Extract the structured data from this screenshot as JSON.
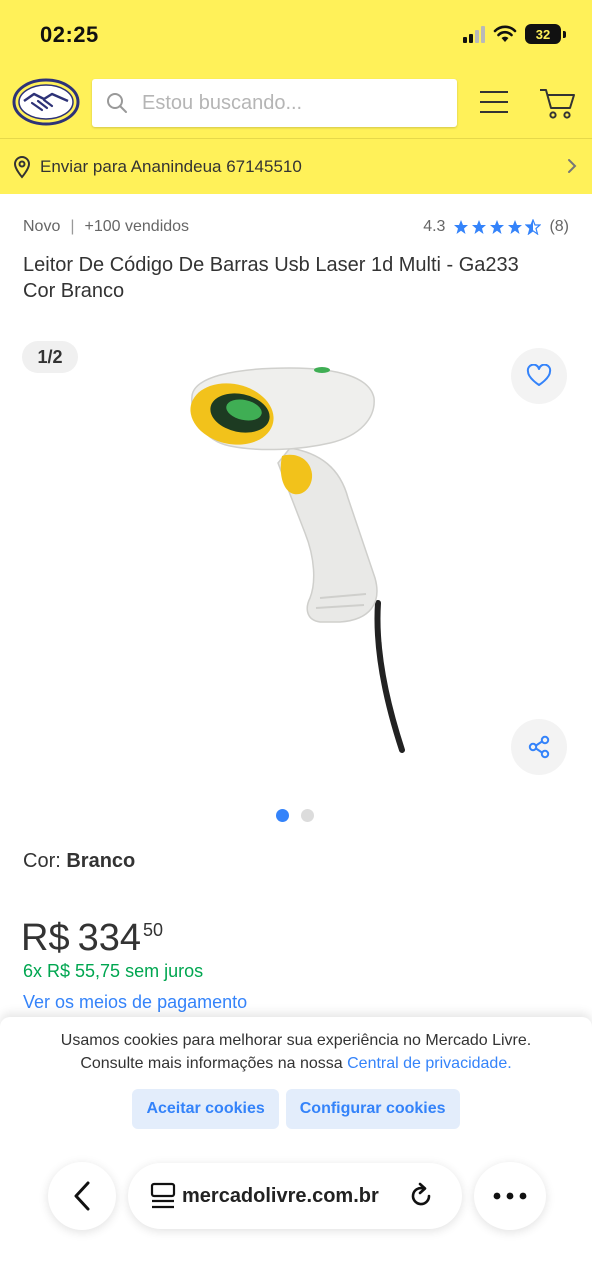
{
  "status_bar": {
    "time": "02:25",
    "battery": "32"
  },
  "header": {
    "logo": "mercado-livre-handshake-logo",
    "search_placeholder": "Estou buscando...",
    "icons": [
      "search-icon",
      "menu-icon",
      "cart-icon"
    ],
    "brand_color": "#fff159"
  },
  "delivery": {
    "text": "Enviar para Ananindeua 67145510"
  },
  "product": {
    "condition": "Novo",
    "separator": "|",
    "sold": "+100 vendidos",
    "rating": "4.3",
    "rating_stars": 4.3,
    "reviews": "(8)",
    "title": "Leitor De Código De Barras Usb Laser 1d Multi - Ga233 Cor Branco"
  },
  "gallery": {
    "page_indicator": "1/2",
    "total_images": 2,
    "current_image": 1
  },
  "variant": {
    "label": "Cor: ",
    "value": "Branco"
  },
  "price": {
    "currency": "R$",
    "integer": "334",
    "cents": "50",
    "installments": "6x R$ 55,75 sem juros",
    "payment_link": "Ver os meios de pagamento"
  },
  "cookies": {
    "text_line1": "Usamos cookies para melhorar sua experiência no Mercado Livre.",
    "text_line2_prefix": "Consulte mais informações na nossa ",
    "privacy_link": "Central de privacidade.",
    "accept_label": "Aceitar cookies",
    "configure_label": "Configurar cookies"
  },
  "browser": {
    "url": "mercadolivre.com.br"
  },
  "colors": {
    "accent_blue": "#3483fa",
    "success_green": "#00a650",
    "star_blue": "#3483fa"
  }
}
